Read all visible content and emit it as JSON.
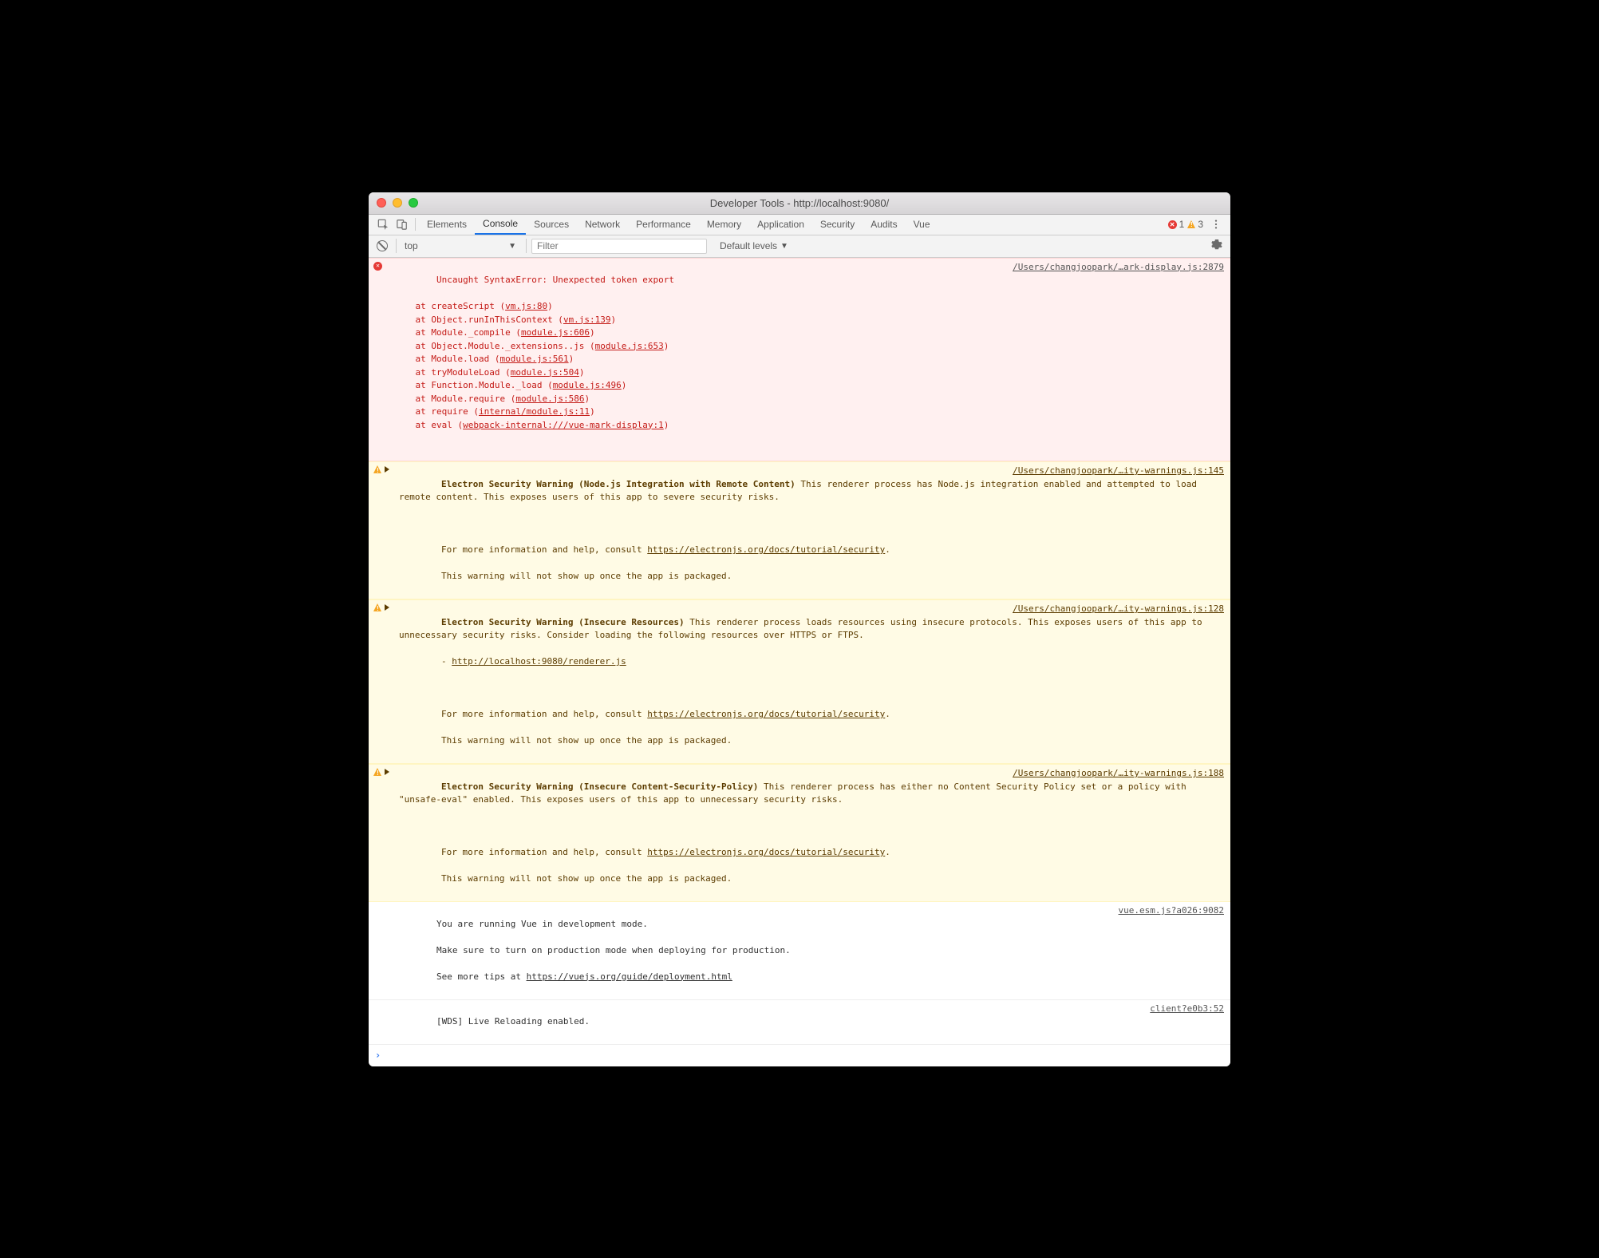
{
  "window": {
    "title": "Developer Tools - http://localhost:9080/"
  },
  "tabs": {
    "items": [
      "Elements",
      "Console",
      "Sources",
      "Network",
      "Performance",
      "Memory",
      "Application",
      "Security",
      "Audits",
      "Vue"
    ],
    "active": "Console"
  },
  "status_badges": {
    "errors": "1",
    "warnings": "3"
  },
  "filterbar": {
    "context": "top",
    "filter_placeholder": "Filter",
    "filter_value": "",
    "levels": "Default levels"
  },
  "messages": {
    "error": {
      "header": "Uncaught SyntaxError: Unexpected token export",
      "source": "/Users/changjoopark/…ark-display.js:2879",
      "stack": [
        {
          "prefix": "at createScript (",
          "link": "vm.js:80",
          "suffix": ")"
        },
        {
          "prefix": "at Object.runInThisContext (",
          "link": "vm.js:139",
          "suffix": ")"
        },
        {
          "prefix": "at Module._compile (",
          "link": "module.js:606",
          "suffix": ")"
        },
        {
          "prefix": "at Object.Module._extensions..js (",
          "link": "module.js:653",
          "suffix": ")"
        },
        {
          "prefix": "at Module.load (",
          "link": "module.js:561",
          "suffix": ")"
        },
        {
          "prefix": "at tryModuleLoad (",
          "link": "module.js:504",
          "suffix": ")"
        },
        {
          "prefix": "at Function.Module._load (",
          "link": "module.js:496",
          "suffix": ")"
        },
        {
          "prefix": "at Module.require (",
          "link": "module.js:586",
          "suffix": ")"
        },
        {
          "prefix": "at require (",
          "link": "internal/module.js:11",
          "suffix": ")"
        },
        {
          "prefix": "at eval (",
          "link": "webpack-internal:///vue-mark-display:1",
          "suffix": ")"
        }
      ]
    },
    "warn1": {
      "title": "Electron Security Warning (Node.js Integration with Remote Content)",
      "body_before": " This renderer process has Node.js integration enabled and attempted to load remote content. This exposes users of this app to severe security risks.",
      "more_prefix": "For more information and help, consult ",
      "more_link": "https://electronjs.org/docs/tutorial/security",
      "tail": "This warning will not show up once the app is packaged.",
      "source": "/Users/changjoopark/…ity-warnings.js:145"
    },
    "warn2": {
      "title": "Electron Security Warning (Insecure Resources)",
      "body_before": " This renderer process loads resources using insecure protocols. This exposes users of this app to unnecessary security risks. Consider loading the following resources over HTTPS or FTPS.",
      "resource_prefix": "- ",
      "resource_link": "http://localhost:9080/renderer.js",
      "more_prefix": "For more information and help, consult ",
      "more_link": "https://electronjs.org/docs/tutorial/security",
      "tail": "This warning will not show up once the app is packaged.",
      "source": "/Users/changjoopark/…ity-warnings.js:128"
    },
    "warn3": {
      "title": "Electron Security Warning (Insecure Content-Security-Policy)",
      "body_before": " This renderer process has either no Content Security Policy set or a policy with \"unsafe-eval\" enabled. This exposes users of this app to unnecessary security risks.",
      "more_prefix": "For more information and help, consult ",
      "more_link": "https://electronjs.org/docs/tutorial/security",
      "tail": "This warning will not show up once the app is packaged.",
      "source": "/Users/changjoopark/…ity-warnings.js:188"
    },
    "vue": {
      "line1": "You are running Vue in development mode.",
      "line2": "Make sure to turn on production mode when deploying for production.",
      "line3_prefix": "See more tips at ",
      "line3_link": "https://vuejs.org/guide/deployment.html",
      "source": "vue.esm.js?a026:9082"
    },
    "wds": {
      "text": "[WDS] Live Reloading enabled.",
      "source": "client?e0b3:52"
    }
  }
}
